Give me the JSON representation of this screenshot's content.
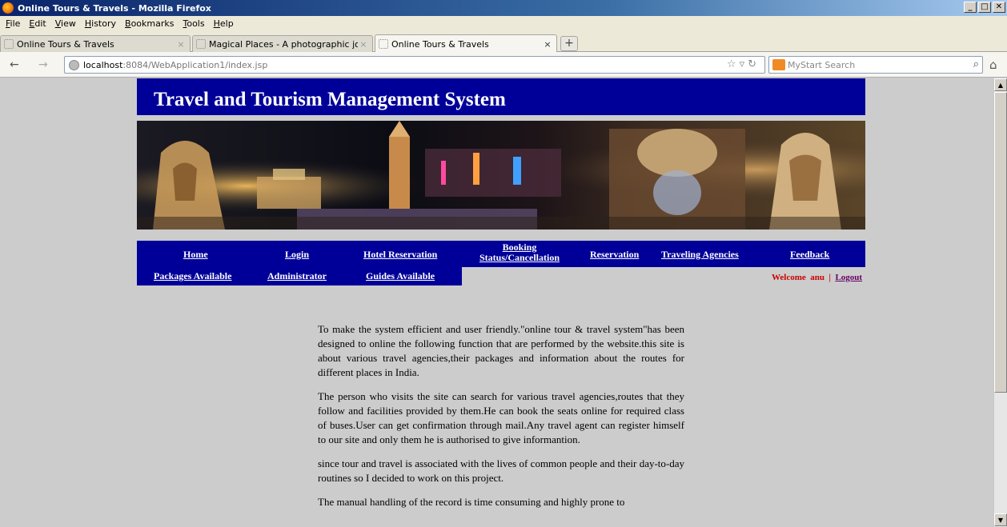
{
  "window": {
    "title": "Online Tours & Travels - Mozilla Firefox",
    "controls": [
      "_",
      "□",
      "✕"
    ]
  },
  "menu": [
    "File",
    "Edit",
    "View",
    "History",
    "Bookmarks",
    "Tools",
    "Help"
  ],
  "tabs": [
    {
      "label": "Online Tours & Travels",
      "close": "×"
    },
    {
      "label": "Magical Places - A photographic journey ...",
      "close": "×"
    },
    {
      "label": "Online Tours & Travels",
      "close": "×"
    }
  ],
  "newtab_label": "+",
  "urlbar": {
    "host": "localhost",
    "rest": ":8084/WebApplication1/index.jsp"
  },
  "searchbar": {
    "placeholder": "MyStart Search"
  },
  "site": {
    "title": "Travel and Tourism Management System",
    "nav_row1": [
      "Home",
      "Login",
      "Hotel Reservation",
      "Booking Status/Cancellation",
      "Reservation",
      "Traveling Agencies",
      "Feedback"
    ],
    "booking_line1": "Booking",
    "booking_line2": "Status/Cancellation",
    "nav_row2": [
      "Packages Available",
      "Administrator",
      "Guides Available"
    ],
    "welcome": {
      "prefix": "Welcome",
      "user": "anu",
      "sep": "|",
      "logout": "Logout"
    },
    "paragraphs": [
      "To make the system efficient and user friendly.\"online tour & travel system\"has been designed to online the following function that are performed by the website.this site is about various travel agencies,their packages and information about the routes for different places in India.",
      "The person who visits the site can search for various travel agencies,routes that they follow and facilities provided by them.He can book the seats online for required class of buses.User can get confirmation through mail.Any travel agent can register himself to our site and only them he is authorised to give informantion.",
      "since tour and travel is associated with the lives of common people and their day-to-day routines so I decided to work on this project.",
      "The manual handling of the record is time consuming and highly prone to"
    ]
  },
  "colors": {
    "nav_bg": "#000099",
    "page_bg": "#cccccc",
    "welcome": "#cc0000",
    "logout": "#660066"
  }
}
